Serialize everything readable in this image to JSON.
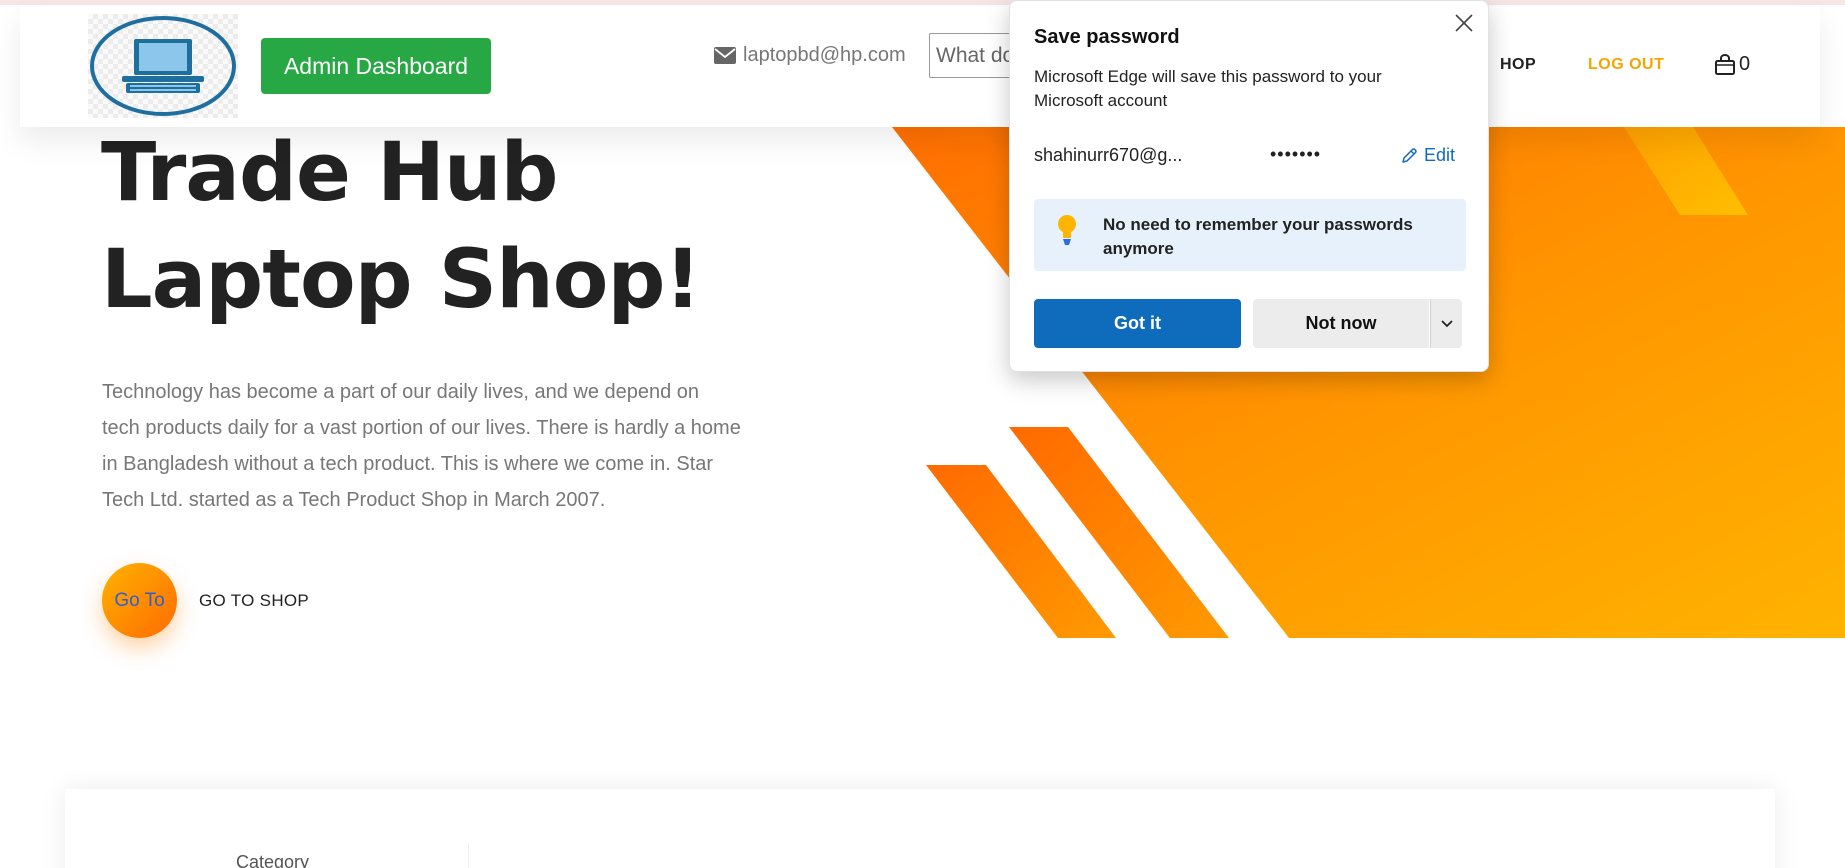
{
  "header": {
    "logo": {
      "alt": "laptop logo",
      "icon": "laptop-icon"
    },
    "admin_button": "Admin Dashboard",
    "contact_email": "laptopbd@hp.com",
    "contact_icon": "envelope-icon",
    "search_placeholder": "What do",
    "nav_shop": "HOP",
    "nav_logout": "LOG OUT",
    "cart_count": "0",
    "cart_icon": "shopping-bag-icon",
    "accent_color": "#f5a500",
    "admin_color": "#28a745"
  },
  "hero": {
    "title_line1": "Trade Hub",
    "title_line2": "Laptop Shop!",
    "description": "Technology has become a part of our daily lives, and we depend on tech products daily for a vast portion of our lives. There is hardly a home in Bangladesh without a tech product. This is where we come in. Star Tech Ltd. started as a Tech Product Shop in March 2007.",
    "goto_circle_label": "Go To",
    "goto_shop_label": "GO TO SHOP"
  },
  "category_panel": {
    "label": "Category"
  },
  "save_password_popup": {
    "title": "Save password",
    "description": "Microsoft Edge will save this password to your Microsoft account",
    "username": "shahinurr670@g...",
    "password_mask": "•••••••",
    "edit_label": "Edit",
    "tip_text": "No need to remember your passwords anymore",
    "got_it_label": "Got it",
    "not_now_label": "Not now",
    "primary_color": "#0f6cbd"
  }
}
